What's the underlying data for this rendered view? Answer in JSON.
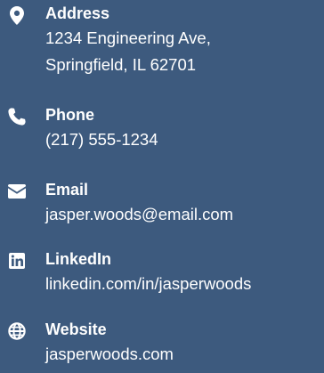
{
  "theme": {
    "background": "#3d5a7e",
    "text": "#ffffff"
  },
  "contact": {
    "address": {
      "icon": "map-pin-icon",
      "label": "Address",
      "line1": "1234 Engineering Ave,",
      "line2": "Springfield, IL 62701"
    },
    "phone": {
      "icon": "phone-icon",
      "label": "Phone",
      "value": "(217) 555-1234"
    },
    "email": {
      "icon": "envelope-icon",
      "label": "Email",
      "value": "jasper.woods@email.com"
    },
    "linkedin": {
      "icon": "linkedin-icon",
      "label": "LinkedIn",
      "value": "linkedin.com/in/jasperwoods"
    },
    "website": {
      "icon": "globe-icon",
      "label": "Website",
      "value": "jasperwoods.com"
    }
  }
}
